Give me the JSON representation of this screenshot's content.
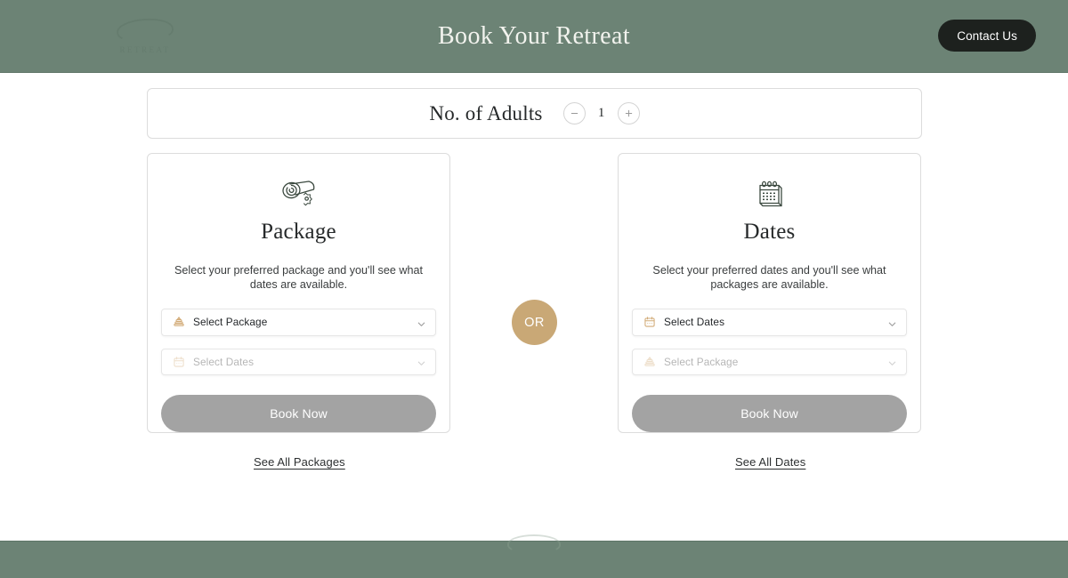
{
  "header": {
    "title": "Book Your Retreat",
    "logo_text": "RETREAT",
    "logo_icon": "leaf-wreath-logo-icon",
    "contact_label": "Contact Us",
    "background_color": "#6c8375",
    "title_color": "#f2f3ee",
    "contact_bg_color": "#1d211e"
  },
  "adults": {
    "label": "No. of Adults",
    "count": "1",
    "decrement_label": "−",
    "increment_label": "+",
    "decrement_icon": "minus-icon",
    "increment_icon": "plus-icon"
  },
  "cards": [
    {
      "key": "package",
      "icon": "rolled-towel-spa-icon",
      "title": "Package",
      "description": "Select your preferred package and you'll see what dates are available.",
      "primary_select": {
        "label": "Select Package",
        "icon": "stacked-towels-icon",
        "disabled": false
      },
      "secondary_select": {
        "label": "Select Dates",
        "icon": "calendar-icon",
        "disabled": true
      },
      "book_label": "Book Now",
      "see_all_label": "See All Packages"
    },
    {
      "key": "dates",
      "icon": "desk-calendar-icon",
      "title": "Dates",
      "description": "Select your preferred dates and you'll see what packages are available.",
      "primary_select": {
        "label": "Select Dates",
        "icon": "calendar-icon",
        "disabled": false
      },
      "secondary_select": {
        "label": "Select Package",
        "icon": "stacked-towels-icon",
        "disabled": true
      },
      "book_label": "Book Now",
      "see_all_label": "See All Dates"
    }
  ],
  "divider": {
    "label": "OR",
    "color": "#c9a876"
  },
  "colors": {
    "brand_green": "#6c8375",
    "accent_gold": "#c9a876",
    "button_disabled": "#a3a3a3",
    "card_border": "#dcdcdc"
  }
}
